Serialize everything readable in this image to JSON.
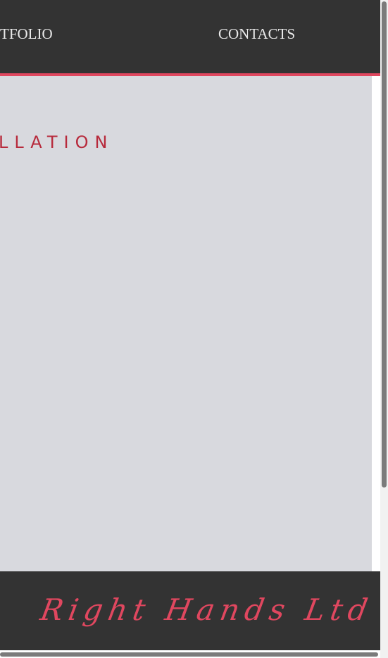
{
  "nav": {
    "items": [
      {
        "label": "TFOLIO"
      },
      {
        "label": "CONTACTS"
      }
    ]
  },
  "main": {
    "heading": "LLATION"
  },
  "footer": {
    "logo_text": "Right Hands Ltd"
  },
  "colors": {
    "header_bg": "#333333",
    "accent": "#e0475f",
    "heading": "#b72a3c",
    "content_bg": "#d8d9de",
    "nav_text": "#e9e9e9"
  }
}
